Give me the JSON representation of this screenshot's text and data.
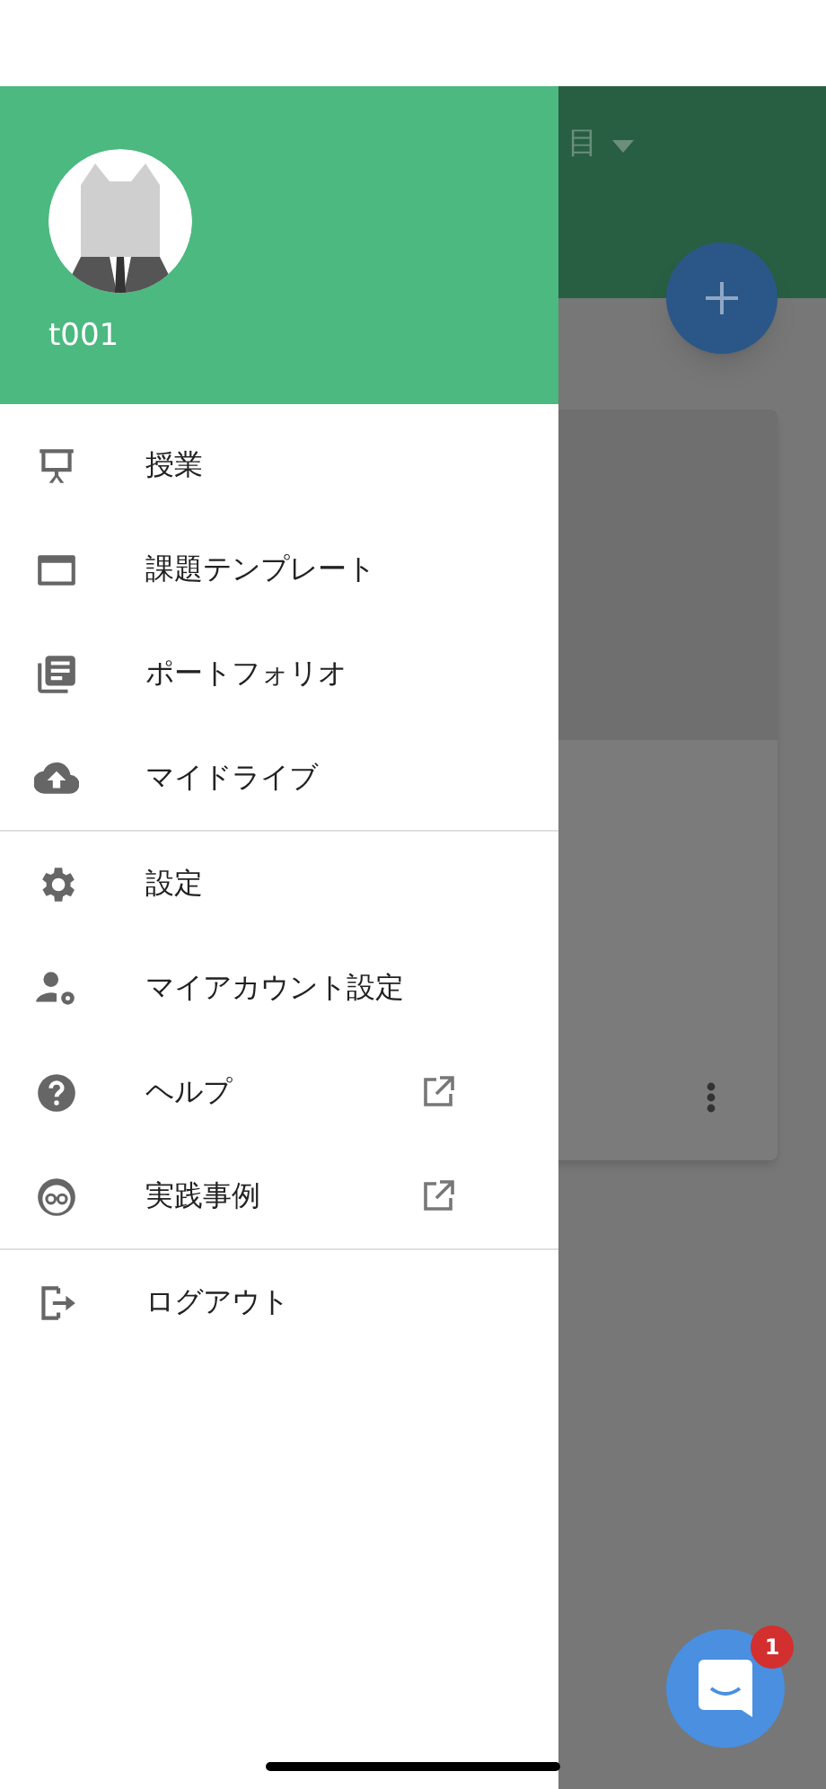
{
  "background": {
    "header_text": "目"
  },
  "drawer": {
    "user": {
      "name": "t001"
    },
    "sections": [
      {
        "items": [
          {
            "label": "授業",
            "external_link": false
          },
          {
            "label": "課題テンプレート",
            "external_link": false
          },
          {
            "label": "ポートフォリオ",
            "external_link": false
          },
          {
            "label": "マイドライブ",
            "external_link": false
          }
        ]
      },
      {
        "items": [
          {
            "label": "設定",
            "external_link": false
          },
          {
            "label": "マイアカウント設定",
            "external_link": false
          },
          {
            "label": "ヘルプ",
            "external_link": true
          },
          {
            "label": "実践事例",
            "external_link": true
          }
        ]
      },
      {
        "items": [
          {
            "label": "ログアウト",
            "external_link": false
          }
        ]
      }
    ]
  },
  "chat": {
    "badge": "1"
  }
}
